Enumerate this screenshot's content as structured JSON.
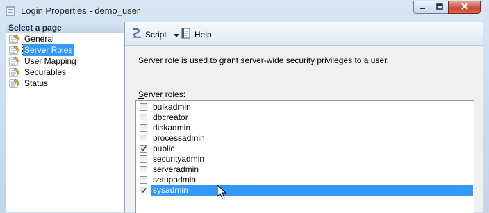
{
  "window": {
    "title": "Login Properties - demo_user"
  },
  "left_pane": {
    "header": "Select a page",
    "items": [
      {
        "label": "General",
        "selected": false
      },
      {
        "label": "Server Roles",
        "selected": true
      },
      {
        "label": "User Mapping",
        "selected": false
      },
      {
        "label": "Securables",
        "selected": false
      },
      {
        "label": "Status",
        "selected": false
      }
    ]
  },
  "toolbar": {
    "script_label": "Script",
    "help_label": "Help"
  },
  "main": {
    "description": "Server role is used to grant server-wide security privileges to a user.",
    "roles_label_underlined": "S",
    "roles_label_rest": "erver roles:",
    "roles": [
      {
        "name": "bulkadmin",
        "checked": false,
        "selected": false
      },
      {
        "name": "dbcreator",
        "checked": false,
        "selected": false
      },
      {
        "name": "diskadmin",
        "checked": false,
        "selected": false
      },
      {
        "name": "processadmin",
        "checked": false,
        "selected": false
      },
      {
        "name": "public",
        "checked": true,
        "selected": false
      },
      {
        "name": "securityadmin",
        "checked": false,
        "selected": false
      },
      {
        "name": "serveradmin",
        "checked": false,
        "selected": false
      },
      {
        "name": "setupadmin",
        "checked": false,
        "selected": false
      },
      {
        "name": "sysadmin",
        "checked": true,
        "selected": true
      }
    ]
  },
  "colors": {
    "selection": "#3399ff",
    "close_button": "#c74a38"
  }
}
